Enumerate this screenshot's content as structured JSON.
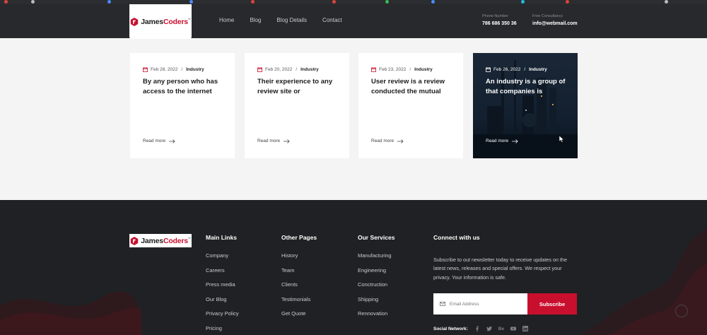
{
  "brand": {
    "name_part1": "James",
    "name_part2": "Coders",
    "tm": "™",
    "color": "#c8102e"
  },
  "nav": [
    "Home",
    "Blog",
    "Blog Details",
    "Contact"
  ],
  "header_contact": [
    {
      "label": "Phone Number",
      "value": "786 686 350 36"
    },
    {
      "label": "Free Consultancy",
      "value": "info@webmail.com"
    }
  ],
  "cards": [
    {
      "date": "Feb 28, 2022",
      "category": "Industry",
      "title": "By any person who has access to the internet",
      "more": "Read more"
    },
    {
      "date": "Feb 20, 2022",
      "category": "Industry",
      "title": "Their experience to any review site or",
      "more": "Read more"
    },
    {
      "date": "Feb 23, 2022",
      "category": "Industry",
      "title": "User review is a review conducted the mutual",
      "more": "Read more"
    },
    {
      "date": "Feb 26, 2022",
      "category": "Industry",
      "title": "An industry is a group of that companies is",
      "more": "Read more"
    }
  ],
  "footer": {
    "columns": [
      {
        "heading": "Main Links",
        "items": [
          "Company",
          "Careers",
          "Press media",
          "Our Blog",
          "Privacy Policy",
          "Pricing"
        ]
      },
      {
        "heading": "Other Pages",
        "items": [
          "History",
          "Team",
          "Clients",
          "Testimonials",
          "Get Quote"
        ]
      },
      {
        "heading": "Our Services",
        "items": [
          "Manufacturing",
          "Engineering",
          "Conctruction",
          "Shipping",
          "Rennovation"
        ]
      }
    ],
    "connect": {
      "heading": "Connect with us",
      "text": "Subscribe to out newsletter today to receive updates on the latest news, releases and special offers. We respect your privacy. Your information is safe.",
      "email_placeholder": "Email Address",
      "subscribe_label": "Subscribe",
      "social_label": "Social Network:",
      "social_icons": [
        "facebook-icon",
        "twitter-icon",
        "behance-icon",
        "youtube-icon",
        "linkedin-icon"
      ],
      "behance_text": "Be"
    }
  }
}
